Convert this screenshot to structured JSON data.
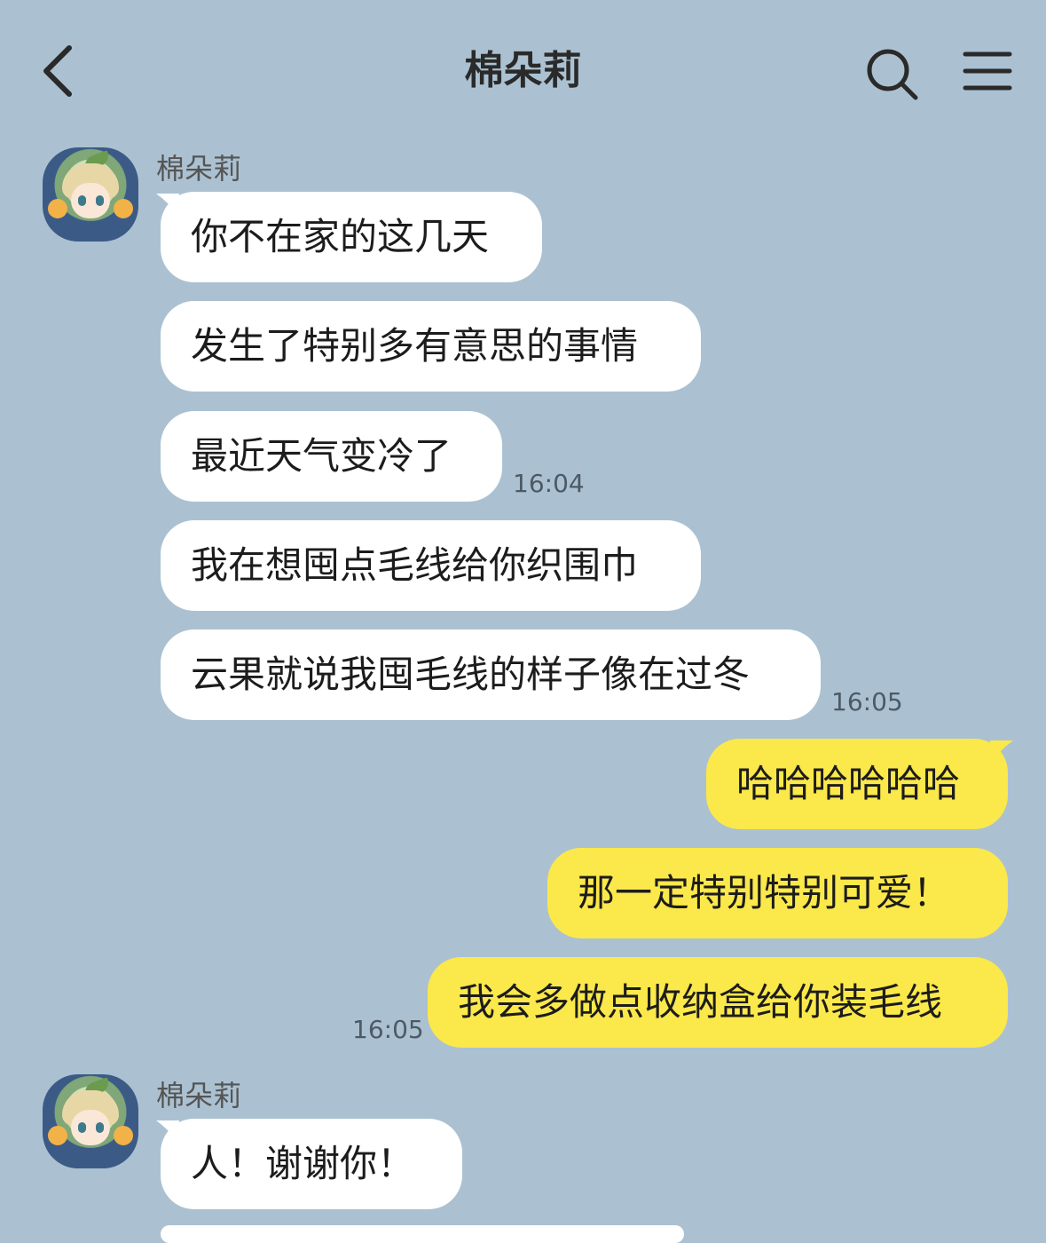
{
  "header": {
    "title": "棉朵莉",
    "back_icon": "chevron-left-icon",
    "search_icon": "search-icon",
    "menu_icon": "hamburger-menu-icon"
  },
  "colors": {
    "background": "#abc1d1",
    "incoming_bubble": "#ffffff",
    "outgoing_bubble": "#fbe84a"
  },
  "groups": [
    {
      "sender": "棉朵莉",
      "messages": [
        "你不在家的这几天",
        "发生了特别多有意思的事情",
        "最近天气变冷了",
        "我在想囤点毛线给你织围巾",
        "云果就说我囤毛线的样子像在过冬"
      ],
      "times": [
        "16:04",
        "16:05"
      ]
    },
    {
      "sender": "me",
      "messages": [
        "哈哈哈哈哈哈",
        "那一定特别特别可爱！",
        "我会多做点收纳盒给你装毛线"
      ],
      "times": [
        "16:05"
      ]
    },
    {
      "sender": "棉朵莉",
      "messages": [
        "人！谢谢你！"
      ]
    }
  ]
}
